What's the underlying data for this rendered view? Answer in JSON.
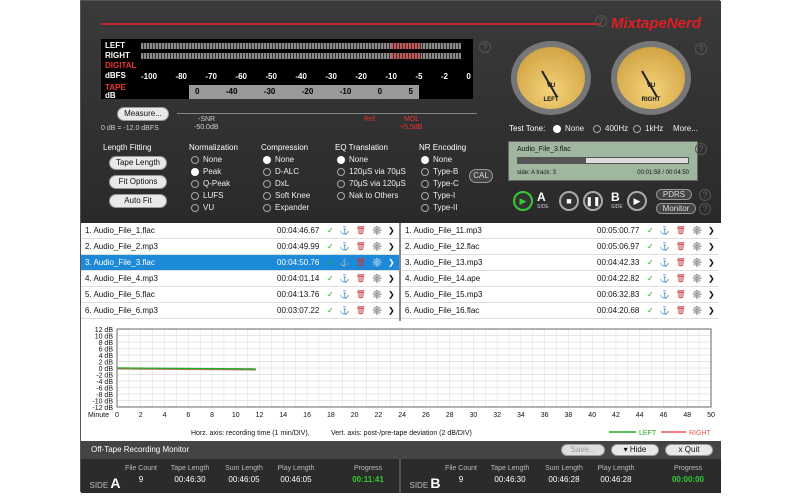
{
  "brand": "MixtapeNerd",
  "meter": {
    "left": "LEFT",
    "right": "RIGHT",
    "digital": "DIGITAL",
    "dbfs": "dBFS",
    "scale": [
      "-100",
      "-80",
      "-70",
      "-60",
      "-50",
      "-40",
      "-30",
      "-20",
      "-10",
      "-5",
      "-2",
      "0"
    ],
    "tape": "TAPE",
    "db": "dB",
    "tape_scale": [
      "0",
      "-40",
      "-30",
      "-20",
      "-10",
      "0",
      "5"
    ]
  },
  "measure": {
    "label": "Measure...",
    "ref": "0 dB = -12.0 dBFS",
    "snr": "-SNR",
    "snr_val": "-50.0dB",
    "refmark": "Ref.",
    "mol": "MOL",
    "mol_val": "+5.5dB"
  },
  "vu": {
    "left": "LEFT",
    "right": "RIGHT",
    "label": "VU",
    "l": "L",
    "r": "R"
  },
  "test_tone": {
    "label": "Test Tone:",
    "options": [
      "None",
      "400Hz",
      "1kHz",
      "More..."
    ]
  },
  "length_fitting": {
    "title": "Length Fitting",
    "buttons": [
      "Tape Length",
      "Fit Options",
      "Auto Fit"
    ]
  },
  "normalization": {
    "title": "Normalization",
    "options": [
      "None",
      "Peak",
      "Q-Peak",
      "LUFS",
      "VU"
    ]
  },
  "compression": {
    "title": "Compression",
    "options": [
      "None",
      "D-ALC",
      "DxL",
      "Soft Knee",
      "Expander"
    ]
  },
  "eq": {
    "title": "EQ Translation",
    "options": [
      "None",
      "120µS via 70µS",
      "70µS via 120µS",
      "Nak to Others"
    ]
  },
  "nr": {
    "title": "NR Encoding",
    "options": [
      "None",
      "Type-B",
      "Type-C",
      "Type-I",
      "Type-II"
    ],
    "cal": "CAL"
  },
  "display": {
    "file": "Audio_File_3.flac",
    "side": "side: A  track: 3",
    "time": "00:01:58 / 00:04:50"
  },
  "transport": {
    "a": "A",
    "b": "B",
    "side": "SIDE",
    "pdrs": "PDRS",
    "monitor": "Monitor"
  },
  "list_a": [
    {
      "name": "1.  Audio_File_1.flac",
      "time": "00:04:46.67"
    },
    {
      "name": "2.  Audio_File_2.mp3",
      "time": "00:04:49.99"
    },
    {
      "name": "3.  Audio_File_3.flac",
      "time": "00:04:50.76"
    },
    {
      "name": "4.  Audio_File_4.mp3",
      "time": "00:04:01.14"
    },
    {
      "name": "5.  Audio_File_5.flac",
      "time": "00:04:13.76"
    },
    {
      "name": "6.  Audio_File_6.mp3",
      "time": "00:03:07.22"
    }
  ],
  "list_b": [
    {
      "name": "1.  Audio_File_11.mp3",
      "time": "00:05:00.77"
    },
    {
      "name": "2.  Audio_File_12.flac",
      "time": "00:05:06.97"
    },
    {
      "name": "3.  Audio_File_13.mp3",
      "time": "00:04:42.33"
    },
    {
      "name": "4.  Audio_File_14.ape",
      "time": "00:04:22.82"
    },
    {
      "name": "5.  Audio_File_15.mp3",
      "time": "00:06:32.83"
    },
    {
      "name": "6.  Audio_File_16.flac",
      "time": "00:04:20.68"
    }
  ],
  "chart": {
    "y_ticks": [
      "12 dB",
      "10 dB",
      "8 dB",
      "6 dB",
      "4 dB",
      "2 dB",
      "0 dB",
      "-2 dB",
      "-4 dB",
      "-6 dB",
      "-8 dB",
      "-10 dB",
      "-12 dB"
    ],
    "x_label": "Minute",
    "x_ticks": [
      "0",
      "2",
      "4",
      "6",
      "8",
      "10",
      "12",
      "14",
      "16",
      "18",
      "20",
      "22",
      "24",
      "26",
      "28",
      "30",
      "32",
      "34",
      "36",
      "38",
      "40",
      "42",
      "44",
      "46",
      "48",
      "50"
    ],
    "horz": "Horz. axis: recording time (1 min/DIV),",
    "vert": "Vert. axis: post-/pre-tape deviation (2 dB/DIV)",
    "left": "LEFT",
    "right": "RIGHT"
  },
  "monitor": {
    "title": "Off-Tape Recording Monitor",
    "save": "Save...",
    "hide": "▾ Hide",
    "quit": "x Quit"
  },
  "side_a": {
    "side": "SIDE",
    "letter": "A",
    "file_count": "9",
    "tape_length": "00:46:30",
    "sum_length": "00:46:05",
    "play_length": "00:46:05",
    "progress": "00:11:41"
  },
  "side_b": {
    "side": "SIDE",
    "letter": "B",
    "file_count": "9",
    "tape_length": "00:46:30",
    "sum_length": "00:46:28",
    "play_length": "00:46:28",
    "progress": "00:00:00"
  },
  "labels": {
    "file_count": "File Count",
    "tape_length": "Tape Length",
    "sum_length": "Sum Length",
    "play_length": "Play Length",
    "progress": "Progress"
  }
}
